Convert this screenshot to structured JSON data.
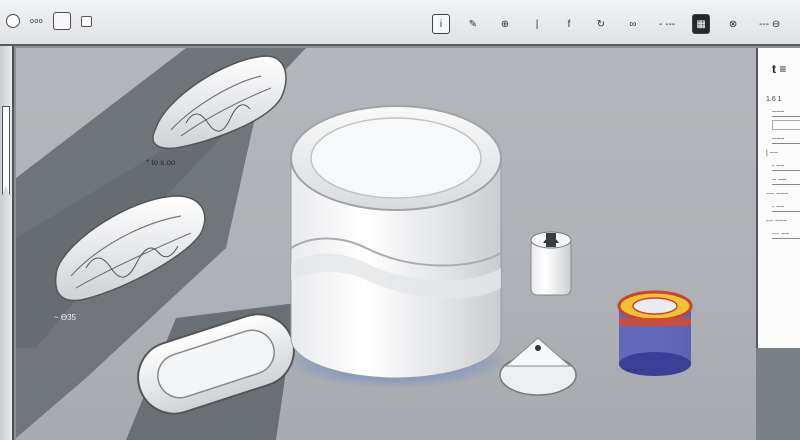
{
  "topbar": {
    "left_text": "ooo",
    "tools": [
      {
        "name": "select",
        "glyph": "i"
      },
      {
        "name": "pen",
        "glyph": "✎"
      },
      {
        "name": "globe",
        "glyph": "⊕"
      },
      {
        "name": "split",
        "glyph": "|"
      },
      {
        "name": "fx",
        "glyph": "f"
      },
      {
        "name": "rotate",
        "glyph": "↻"
      },
      {
        "name": "infinity",
        "glyph": "∞"
      },
      {
        "name": "dash",
        "glyph": "- ---"
      },
      {
        "name": "grid",
        "glyph": "▦"
      },
      {
        "name": "snap",
        "glyph": "⊗"
      },
      {
        "name": "more",
        "glyph": "--- ⊖"
      }
    ]
  },
  "canvas": {
    "label_top": "* to s.oo",
    "label_bottom": "~ Ɵ35",
    "label_connector": "~ ~ ~"
  },
  "right_panel": {
    "header": "t ≡",
    "value": "1.6 1",
    "fields": [
      "~~~",
      "~~~",
      "- ~~",
      "~ ~~",
      "- ~~",
      "--- ~~"
    ],
    "labels": [
      "| ~~",
      "~~ ~~~",
      "--- ~~~"
    ]
  }
}
